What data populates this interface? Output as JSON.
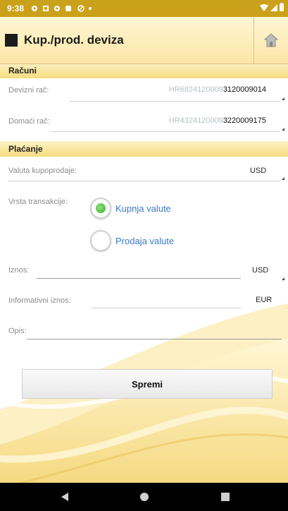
{
  "status_bar": {
    "time": "9:38"
  },
  "app_bar": {
    "title": "Kup./prod. deviza"
  },
  "racuni": {
    "header": "Računi",
    "devizni": {
      "label": "Devizni rač:",
      "prefix": "HR6824120009",
      "suffix": "3120009014"
    },
    "domaci": {
      "label": "Domaći rač:",
      "prefix": "HR4324120009",
      "suffix": "3220009175"
    }
  },
  "placanje": {
    "header": "Plaćanje",
    "valuta": {
      "label": "Valuta kupoprodaje:",
      "value": "USD"
    },
    "vrsta": {
      "label": "Vrsta transakcije:",
      "options": [
        {
          "label": "Kupnja valute",
          "selected": true
        },
        {
          "label": "Prodaja valute",
          "selected": false
        }
      ]
    },
    "iznos": {
      "label": "Iznos:",
      "value": "",
      "currency": "USD"
    },
    "informativni": {
      "label": "Informativni iznos:",
      "value": "",
      "currency": "EUR"
    },
    "opis": {
      "label": "Opis:",
      "value": ""
    }
  },
  "save_label": "Spremi",
  "colors": {
    "accent": "#caa11a",
    "section": "#f6dc80",
    "radio_on": "#3cae2c",
    "link": "#3b78c4"
  }
}
